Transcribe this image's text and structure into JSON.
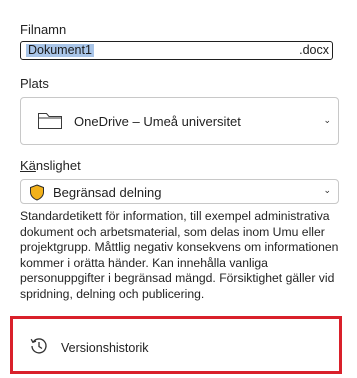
{
  "filename": {
    "label": "Filnamn",
    "value": "Dokument1",
    "extension": ".docx"
  },
  "location": {
    "label": "Plats",
    "value": "OneDrive – Umeå universitet",
    "icon": "folder-icon"
  },
  "sensitivity": {
    "label_underlined": "Kä",
    "label_rest": "nslighet",
    "value": "Begränsad delning",
    "icon": "shield-icon",
    "shield_color": "#f2b11a",
    "description": "Standardetikett för information, till exempel administrativa dokument och arbetsmaterial, som delas inom Umu eller projektgrupp. Måttlig negativ konsekvens om informationen kommer i orätta händer. Kan innehålla vanliga personuppgifter i begränsad mängd. Försiktighet gäller vid spridning, delning och publicering."
  },
  "version_history": {
    "label": "Versionshistorik",
    "icon": "history-icon",
    "highlight_color": "#d9202a"
  }
}
